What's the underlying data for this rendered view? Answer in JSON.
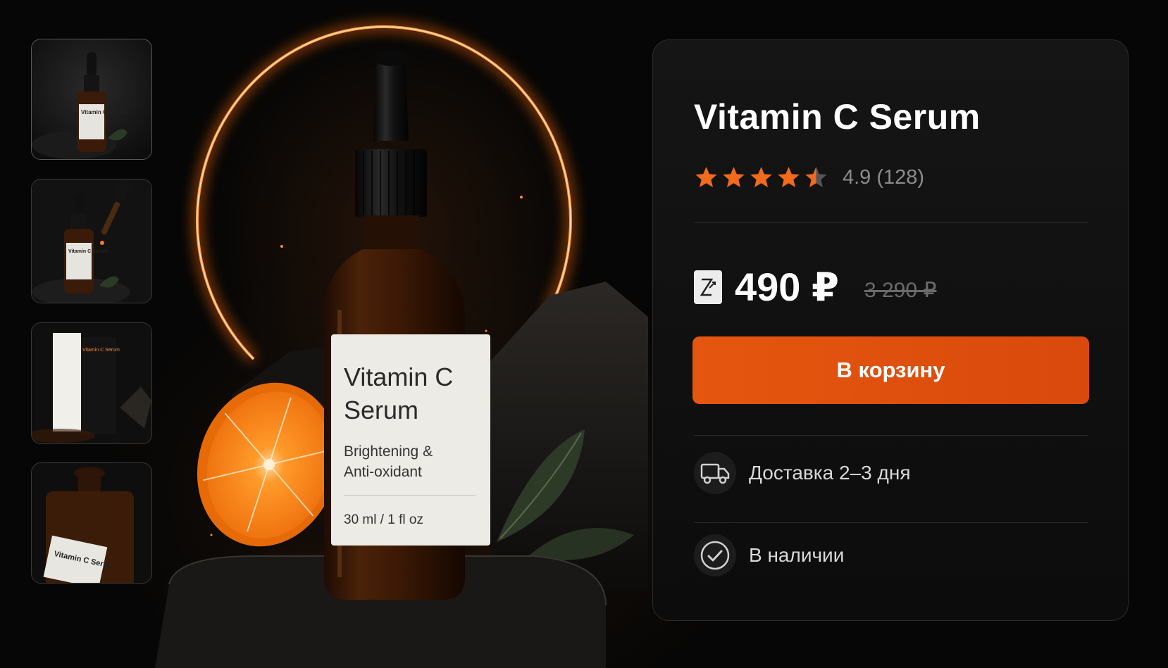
{
  "gallery": {
    "thumbnails": [
      {
        "label": "Vitamin C Serum"
      },
      {
        "label": "Vitamin C Serum"
      },
      {
        "label": "Vitamin C Serum"
      },
      {
        "label": "Vitamin C Serum"
      }
    ]
  },
  "hero": {
    "label_title_line1": "Vitamin C",
    "label_title_line2": "Serum",
    "label_sub_line1": "Brightening &",
    "label_sub_line2": "Anti-oxidant",
    "label_volume": "30 ml / 1 fl oz"
  },
  "product": {
    "title": "Vitamin C Serum",
    "rating_value": 4.5,
    "rating_text": "4.9 (128)",
    "price": "490 ₽",
    "old_price": "3 290 ₽",
    "cart_label": "В корзину",
    "delivery_text": "Доставка 2–3 дня",
    "stock_text": "В наличии"
  },
  "colors": {
    "accent": "#e5570f",
    "star": "#f26a1b",
    "star_empty": "#555555",
    "glow": "#ff8a2a"
  },
  "icons": {
    "pay": "payment-card-icon",
    "delivery": "truck-icon",
    "stock": "checkmark-circle-icon"
  }
}
